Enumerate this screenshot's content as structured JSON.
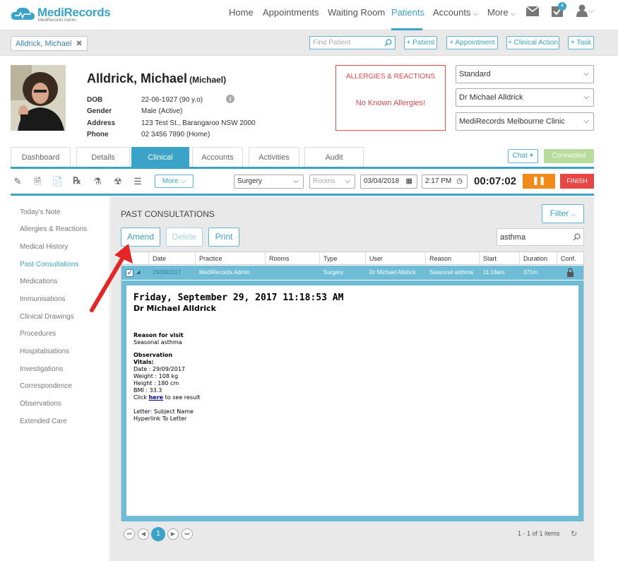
{
  "app": {
    "brand": "MediRecords",
    "brand_sub": "MediRecords Admin"
  },
  "nav": {
    "home": "Home",
    "appointments": "Appointments",
    "waiting_room": "Waiting Room",
    "patients": "Patients",
    "accounts": "Accounts",
    "more": "More",
    "badge": "4"
  },
  "patient_bar": {
    "chip": "Alldrick, Michael",
    "find_placeholder": "Find Patient",
    "add_patient": "+ Patient",
    "add_appointment": "+ Appointment",
    "add_clinical_action": "+ Clinical Action",
    "add_task": "+ Task"
  },
  "patient": {
    "name": "Alldrick, Michael",
    "preferred": "(Michael)",
    "dob_label": "DOB",
    "dob": "22-06-1927 (90 y.o)",
    "gender_label": "Gender",
    "gender": "Male (Active)",
    "address_label": "Address",
    "address": "123 Test St., Barangaroo NSW 2000",
    "phone_label": "Phone",
    "phone": "02 3456 7890 (Home)"
  },
  "allergies": {
    "title": "ALLERGIES & REACTIONS",
    "text": "No Known Allergies!"
  },
  "selects": {
    "billing": "Standard",
    "doctor": "Dr Michael Alldrick",
    "clinic": "MediRecords Melbourne Clinic"
  },
  "tabs": [
    "Dashboard",
    "Details",
    "Clinical",
    "Accounts",
    "Activities",
    "Audit"
  ],
  "chat": {
    "label": "Chat",
    "status": "Connected"
  },
  "toolbar": {
    "more": "More",
    "location": "Surgery",
    "rooms_placeholder": "Rooms",
    "date": "03/04/2018",
    "time": "2:17 PM",
    "timer": "00:07:02",
    "finish": "FINISH"
  },
  "sidebar": [
    "Today's Note",
    "Allergies & Reactions",
    "Medical History",
    "Past Consultations",
    "Medications",
    "Immunisations",
    "Clinical Drawings",
    "Procedures",
    "Hospitalisations",
    "Investigations",
    "Correspondence",
    "Observations",
    "Extended Care"
  ],
  "main": {
    "title": "PAST CONSULTATIONS",
    "filter": "Filter",
    "amend": "Amend",
    "delete": "Delete",
    "print": "Print",
    "search_value": "asthma"
  },
  "table": {
    "headers": [
      "Date",
      "Practice",
      "Rooms",
      "Type",
      "User",
      "Reason",
      "Start",
      "Duration",
      "Conf."
    ],
    "row": {
      "date": "29/09/2017",
      "practice": "MediRecords Admin",
      "rooms": "",
      "type": "Surgery",
      "user": "Dr Michael Alldrick",
      "reason": "Seasonal asthma",
      "start": "11:18am",
      "duration": "371m"
    }
  },
  "note": {
    "datetime": "Friday, September 29, 2017 11:18:53 AM",
    "doctor": "Dr Michael Alldrick",
    "reason_label": "Reason for visit",
    "reason": "Seasonal asthma",
    "observation_label": "Observation",
    "vitals_label": "Vitals:",
    "date_line": "Date : 29/09/2017",
    "weight_line": "Weight : 108 kg",
    "height_line": "Height : 180 cm",
    "bmi_line": "BMI : 33.3",
    "click": "Click",
    "here": "here",
    "to_see": "to see result",
    "letter_line": "Letter: Subject Name",
    "hyperlink_line": "Hyperlink To Letter"
  },
  "pagination": {
    "page": "1",
    "summary": "1 - 1 of 1 items"
  },
  "colors": {
    "accent": "#3aa3c7",
    "allergy": "#e04a4a",
    "pause": "#f08a1a",
    "finish": "#e84545",
    "connected": "#b7dc9c"
  }
}
